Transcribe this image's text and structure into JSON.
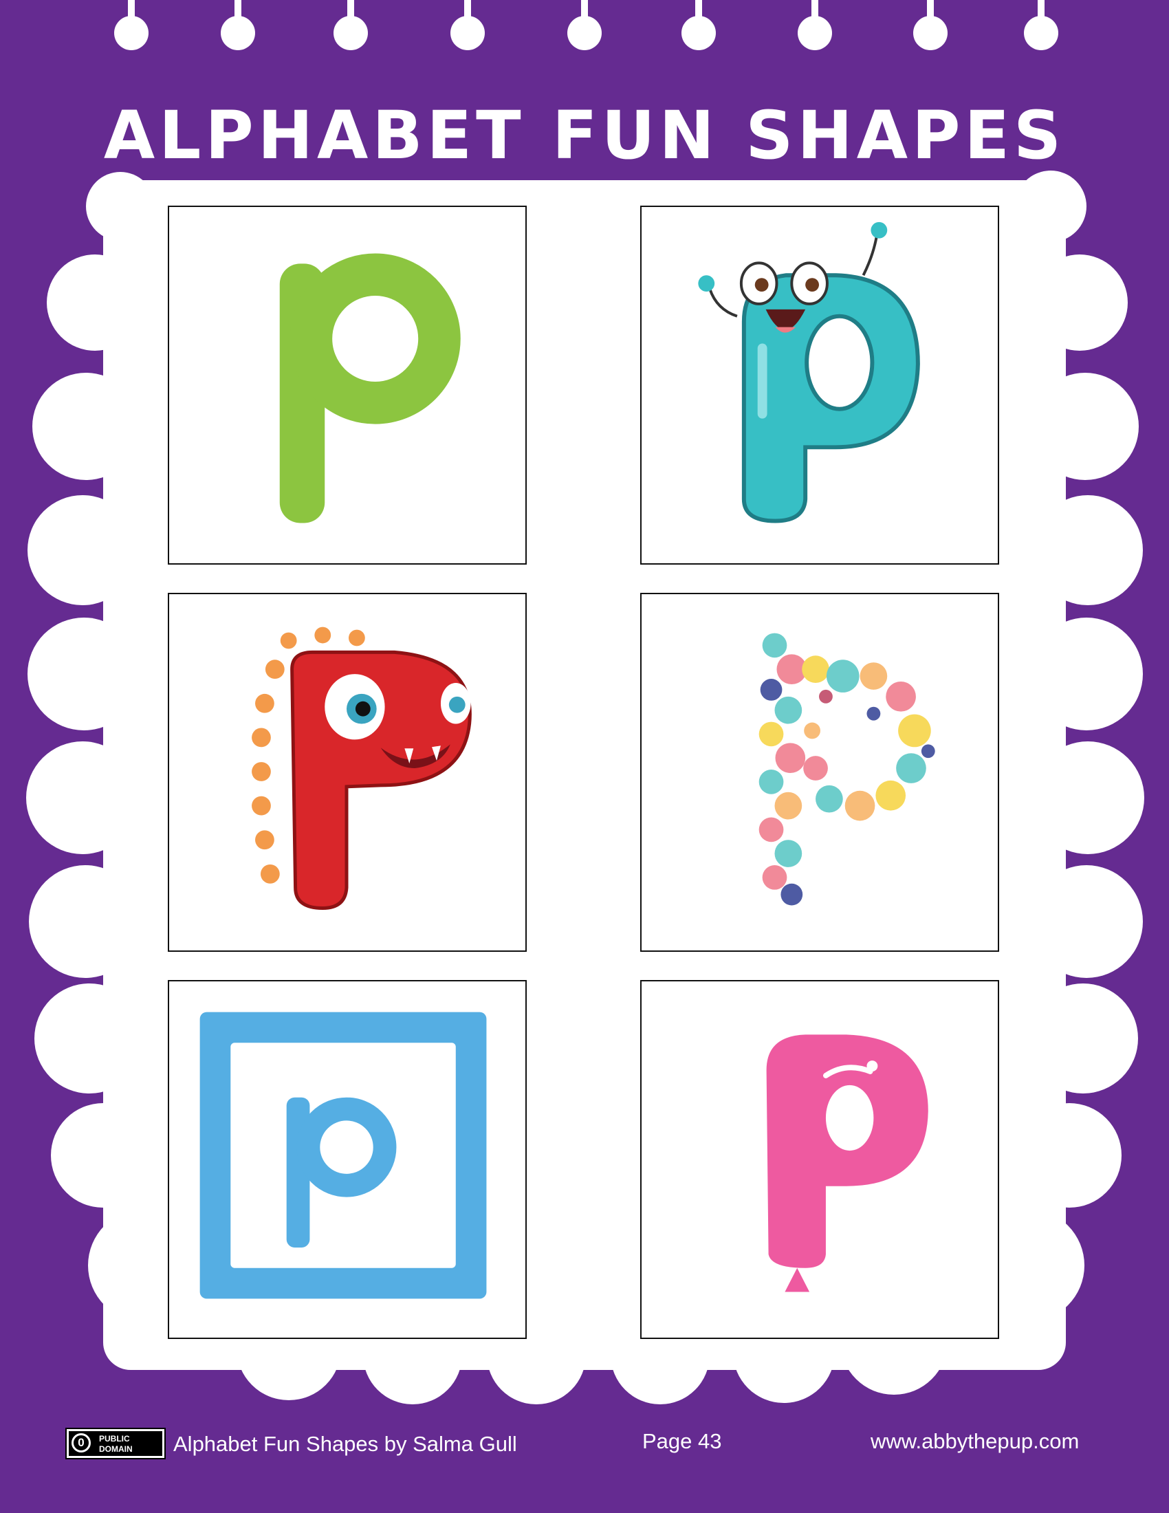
{
  "colors": {
    "background": "#652b91",
    "panel": "#ffffff",
    "green_letter": "#8cc540",
    "teal_letter": "#37bfc5",
    "red_letter": "#d9262a",
    "blue_letter": "#55aee3",
    "pink_letter": "#ee5aa0"
  },
  "header": {
    "title": "ALPHABET FUN SHAPES"
  },
  "cards": [
    {
      "letter": "p",
      "style": "plain-green-lowercase"
    },
    {
      "letter": "P",
      "style": "teal-cartoon-character-icon"
    },
    {
      "letter": "P",
      "style": "red-monster-character-icon"
    },
    {
      "letter": "p",
      "style": "bubble-dots-icon"
    },
    {
      "letter": "p",
      "style": "blue-framed-lowercase"
    },
    {
      "letter": "p",
      "style": "pink-balloon-icon"
    }
  ],
  "footer": {
    "license_line1": "PUBLIC",
    "license_line2": "DOMAIN",
    "license_symbol": "0",
    "credit": "Alphabet Fun Shapes by Salma Gull",
    "page": "Page 43",
    "website": "www.abbythepup.com"
  }
}
